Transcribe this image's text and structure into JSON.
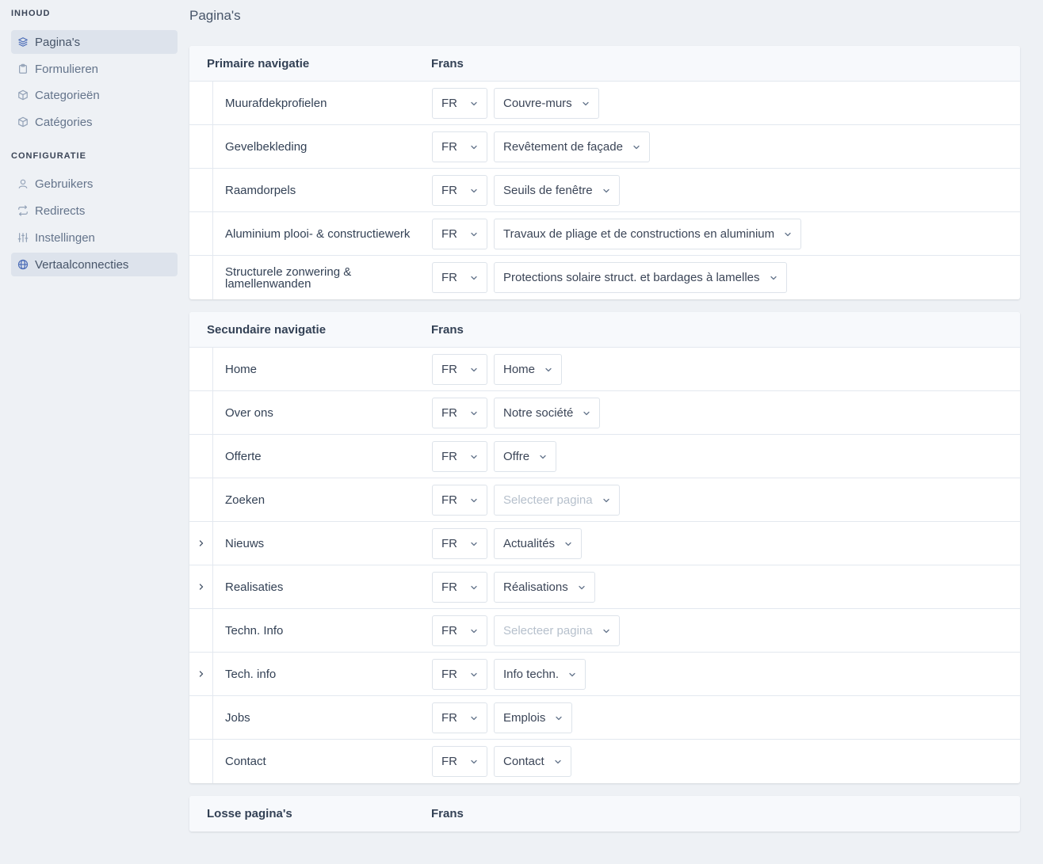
{
  "sidebar": {
    "sections": [
      {
        "title": "INHOUD",
        "items": [
          {
            "label": "Pagina's",
            "icon": "layers-icon",
            "active": true
          },
          {
            "label": "Formulieren",
            "icon": "clipboard-icon",
            "active": false
          },
          {
            "label": "Categorieën",
            "icon": "cube-icon",
            "active": false
          },
          {
            "label": "Catégories",
            "icon": "cube-icon",
            "active": false
          }
        ]
      },
      {
        "title": "CONFIGURATIE",
        "items": [
          {
            "label": "Gebruikers",
            "icon": "user-icon",
            "active": false
          },
          {
            "label": "Redirects",
            "icon": "arrows-icon",
            "active": false
          },
          {
            "label": "Instellingen",
            "icon": "sliders-icon",
            "active": false
          },
          {
            "label": "Vertaalconnecties",
            "icon": "globe-icon",
            "active": true
          }
        ]
      }
    ]
  },
  "page_title": "Pagina's",
  "cards": [
    {
      "title": "Primaire navigatie",
      "language_header": "Frans",
      "rows": [
        {
          "name": "Muurafdekprofielen",
          "expandable": false,
          "lang": "FR",
          "page": "Couvre-murs",
          "placeholder": false
        },
        {
          "name": "Gevelbekleding",
          "expandable": false,
          "lang": "FR",
          "page": "Revêtement de façade",
          "placeholder": false
        },
        {
          "name": "Raamdorpels",
          "expandable": false,
          "lang": "FR",
          "page": "Seuils de fenêtre",
          "placeholder": false
        },
        {
          "name": "Aluminium plooi- & constructiewerk",
          "expandable": false,
          "lang": "FR",
          "page": "Travaux de pliage et de constructions en aluminium",
          "placeholder": false
        },
        {
          "name": "Structurele zonwering & lamellenwanden",
          "expandable": false,
          "lang": "FR",
          "page": "Protections solaire struct. et bardages à lamelles",
          "placeholder": false
        }
      ]
    },
    {
      "title": "Secundaire navigatie",
      "language_header": "Frans",
      "rows": [
        {
          "name": "Home",
          "expandable": false,
          "lang": "FR",
          "page": "Home",
          "placeholder": false
        },
        {
          "name": "Over ons",
          "expandable": false,
          "lang": "FR",
          "page": "Notre société",
          "placeholder": false
        },
        {
          "name": "Offerte",
          "expandable": false,
          "lang": "FR",
          "page": "Offre",
          "placeholder": false
        },
        {
          "name": "Zoeken",
          "expandable": false,
          "lang": "FR",
          "page": "Selecteer pagina",
          "placeholder": true
        },
        {
          "name": "Nieuws",
          "expandable": true,
          "lang": "FR",
          "page": "Actualités",
          "placeholder": false
        },
        {
          "name": "Realisaties",
          "expandable": true,
          "lang": "FR",
          "page": "Réalisations",
          "placeholder": false
        },
        {
          "name": "Techn. Info",
          "expandable": false,
          "lang": "FR",
          "page": "Selecteer pagina",
          "placeholder": true
        },
        {
          "name": "Tech. info",
          "expandable": true,
          "lang": "FR",
          "page": "Info techn.",
          "placeholder": false
        },
        {
          "name": "Jobs",
          "expandable": false,
          "lang": "FR",
          "page": "Emplois",
          "placeholder": false
        },
        {
          "name": "Contact",
          "expandable": false,
          "lang": "FR",
          "page": "Contact",
          "placeholder": false
        }
      ]
    },
    {
      "title": "Losse pagina's",
      "language_header": "Frans",
      "rows": []
    }
  ],
  "colors": {
    "background": "#eef1f5",
    "active_nav": "#dde3ec",
    "accent_icon": "#4b6cb7",
    "placeholder_text": "#b6c0cc"
  }
}
